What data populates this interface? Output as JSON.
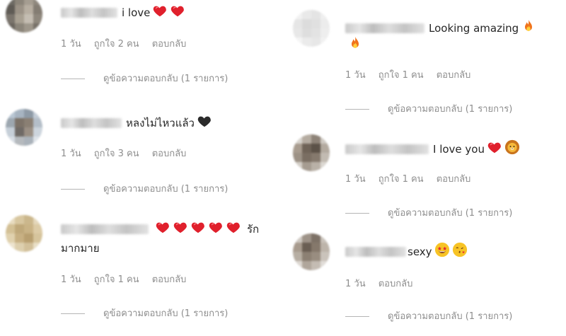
{
  "comments_left": [
    {
      "text": "i love",
      "emojis": [
        "heart",
        "heart"
      ],
      "continuation": "",
      "age": "1 วัน",
      "likes": "ถูกใจ 2 คน",
      "reply": "ตอบกลับ",
      "view_replies": "ดูข้อความตอบกลับ (1 รายการ)",
      "avatar_colors": [
        "#6d6a63",
        "#8b8479",
        "#a59d91",
        "#8f887e",
        "#5f5b55",
        "#9b9286",
        "#b7aea1",
        "#847d73",
        "#7a746c",
        "#a8a092",
        "#c4bdb2",
        "#8f887d",
        "#6a655e",
        "#8b857a",
        "#9e978b",
        "#777168"
      ]
    },
    {
      "text": "หลงไม่ไหวแล้ว",
      "emojis": [
        "black-heart"
      ],
      "continuation": "",
      "age": "1 วัน",
      "likes": "ถูกใจ 3 คน",
      "reply": "ตอบกลับ",
      "view_replies": "ดูข้อความตอบกลับ (1 รายการ)",
      "avatar_colors": [
        "#b9c6d3",
        "#a7b4c1",
        "#8e9aa6",
        "#c3ccd6",
        "#9da7b0",
        "#7c7268",
        "#8a7f73",
        "#b4bec8",
        "#c6cfd8",
        "#6f6a66",
        "#9a8f84",
        "#cdd5dd",
        "#d7dde4",
        "#b5b9bd",
        "#aab2ba",
        "#dfe4e9"
      ]
    },
    {
      "text": "รัก",
      "emojis": [
        "heart",
        "heart",
        "heart",
        "heart",
        "heart"
      ],
      "continuation": "มากมาย",
      "age": "1 วัน",
      "likes": "ถูกใจ 1 คน",
      "reply": "ตอบกลับ",
      "view_replies": "ดูข้อความตอบกลับ (1 รายการ)",
      "avatar_colors": [
        "#e8dcc0",
        "#d8c7a0",
        "#cbb78c",
        "#e4d7bb",
        "#d3c095",
        "#bfa87a",
        "#c9b386",
        "#dccba6",
        "#e0d1ae",
        "#c7b083",
        "#b89f70",
        "#d6c49c",
        "#ede4cf",
        "#ddcfae",
        "#d2c09a",
        "#e9dfc7"
      ]
    }
  ],
  "comments_right": [
    {
      "text": "Looking amazing",
      "emojis": [
        "fire"
      ],
      "continuation_emoji": "fire",
      "age": "1 วัน",
      "likes": "ถูกใจ 1 คน",
      "reply": "ตอบกลับ",
      "view_replies": "ดูข้อความตอบกลับ (1 รายการ)",
      "avatar_colors": [
        "#f2f2f2",
        "#e9e9e9",
        "#e4e4e4",
        "#efefef",
        "#e6e6e6",
        "#dcdcdc",
        "#e0e0e0",
        "#ececec",
        "#e8e8e8",
        "#dedede",
        "#e3e3e3",
        "#eeeeee",
        "#f4f4f4",
        "#ebebeb",
        "#e7e7e7",
        "#f1f1f1"
      ]
    },
    {
      "text": "I love you",
      "emojis": [
        "heart",
        "lion"
      ],
      "continuation_emoji": "",
      "age": "1 วัน",
      "likes": "ถูกใจ 1 คน",
      "reply": "ตอบกลับ",
      "view_replies": "ดูข้อความตอบกลับ (1 รายการ)",
      "avatar_colors": [
        "#d8d4ce",
        "#b5aca1",
        "#8e8378",
        "#cfcac3",
        "#a89c8f",
        "#6f6357",
        "#5c5248",
        "#b3aa9f",
        "#9d9286",
        "#7a6e62",
        "#85796d",
        "#c2bbb2",
        "#d4cfc8",
        "#a69c91",
        "#b9b1a7",
        "#dcd8d2"
      ]
    },
    {
      "text": "sexy",
      "emojis": [
        "star-struck",
        "kiss-face"
      ],
      "continuation_emoji": "",
      "age": "1 วัน",
      "likes": "",
      "reply": "ตอบกลับ",
      "view_replies": "ดูข้อความตอบกลับ (1 รายการ)",
      "avatar_colors": [
        "#cfc9c2",
        "#9e9388",
        "#7d7166",
        "#c9c2ba",
        "#a89b8e",
        "#6a5e53",
        "#85786b",
        "#bdb4aa",
        "#b7aea3",
        "#8c8073",
        "#998d80",
        "#cac3bb",
        "#ddd8d2",
        "#b0a69b",
        "#c4bcb3",
        "#e1ddd8"
      ]
    }
  ],
  "colors": {
    "heart": "#e0202c",
    "meta": "#8e8e8e",
    "fire": "#f0731c"
  }
}
